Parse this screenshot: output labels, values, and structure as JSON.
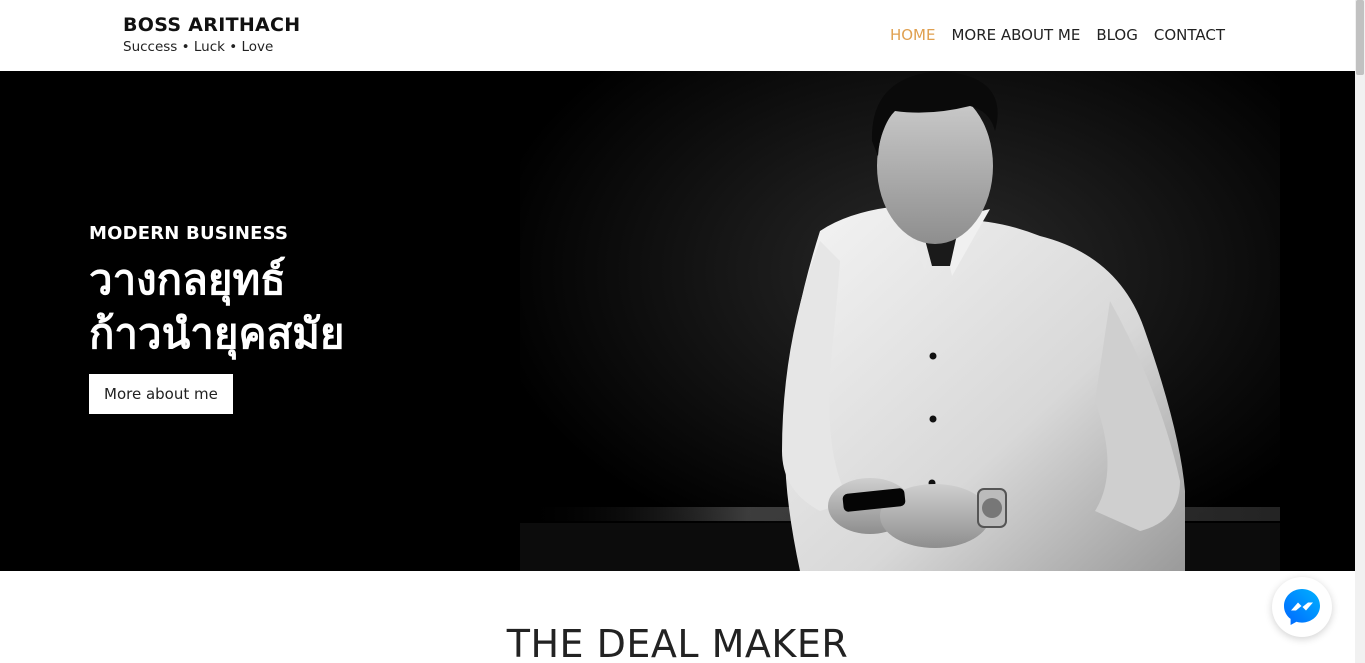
{
  "brand": {
    "title": "BOSS ARITHACH",
    "tagline": "Success • Luck • Love"
  },
  "nav": {
    "items": [
      {
        "label": "HOME",
        "active": true
      },
      {
        "label": "MORE ABOUT ME",
        "active": false
      },
      {
        "label": "BLOG",
        "active": false
      },
      {
        "label": "CONTACT",
        "active": false
      }
    ]
  },
  "hero": {
    "kicker": "MODERN BUSINESS",
    "heading_line1": "วางกลยุทธ์",
    "heading_line2": "ก้าวนำยุคสมัย",
    "button_label": "More about me"
  },
  "section": {
    "title": "THE DEAL MAKER"
  },
  "colors": {
    "accent": "#e0a050",
    "hero_bg": "#000000",
    "messenger_blue": "#1877f2"
  },
  "icons": {
    "chat": "messenger-icon"
  }
}
